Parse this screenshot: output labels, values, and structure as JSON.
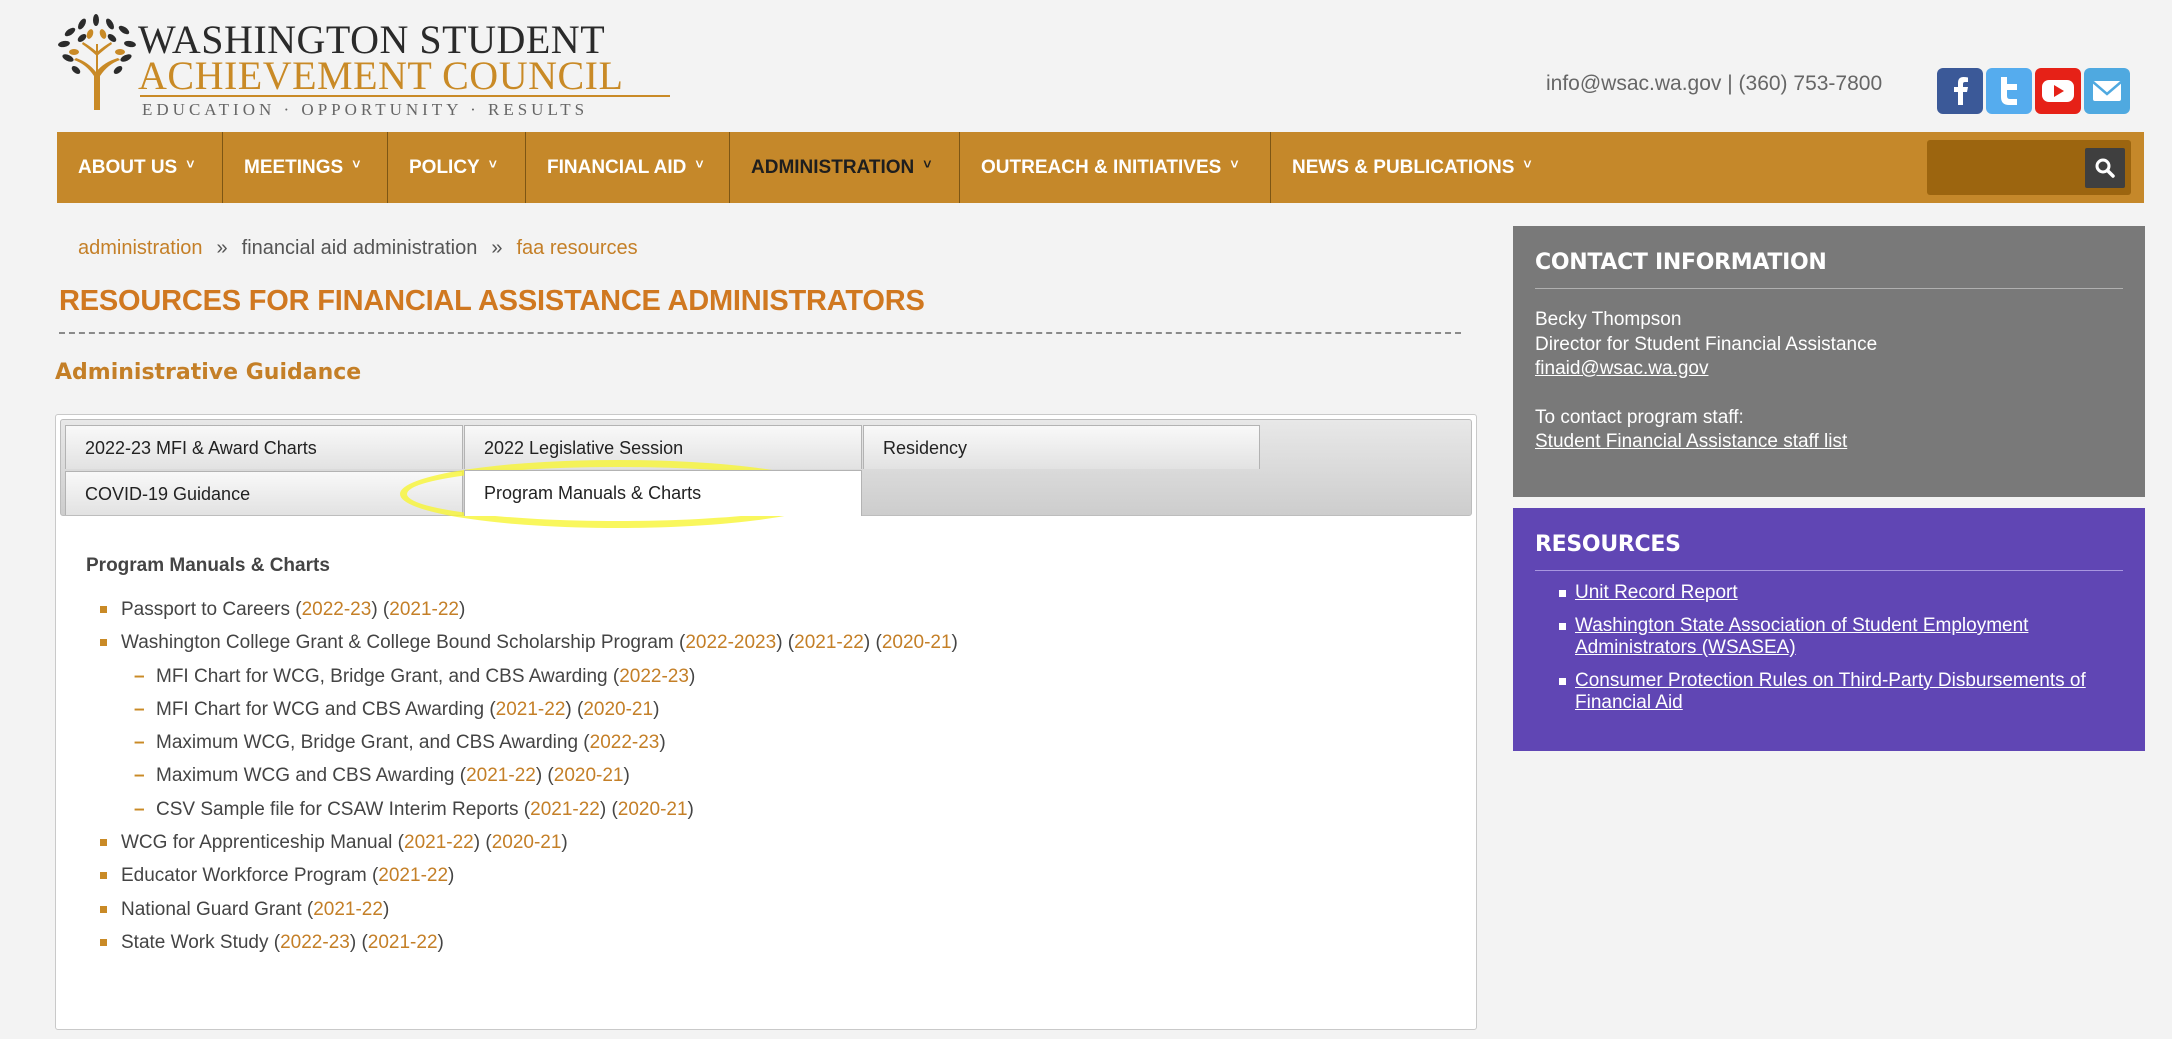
{
  "header": {
    "logo_line1": "WASHINGTON STUDENT",
    "logo_line2": "ACHIEVEMENT COUNCIL",
    "logo_tagline": "EDUCATION · OPPORTUNITY · RESULTS",
    "contact_email": "info@wsac.wa.gov",
    "contact_separator": " | ",
    "contact_phone": "(360) 753-7800",
    "social": [
      {
        "icon": "facebook-icon",
        "color": "#3b5998"
      },
      {
        "icon": "twitter-icon",
        "color": "#55acee"
      },
      {
        "icon": "youtube-icon",
        "color": "#e62117"
      },
      {
        "icon": "email-icon",
        "color": "#4fa9e0"
      }
    ]
  },
  "nav": {
    "items": [
      {
        "label": "ABOUT US",
        "active": false
      },
      {
        "label": "MEETINGS",
        "active": false
      },
      {
        "label": "POLICY",
        "active": false
      },
      {
        "label": "FINANCIAL AID",
        "active": false
      },
      {
        "label": "ADMINISTRATION",
        "active": true
      },
      {
        "label": "OUTREACH & INITIATIVES",
        "active": false
      },
      {
        "label": "NEWS & PUBLICATIONS",
        "active": false
      }
    ],
    "caret": "˅",
    "search_icon": "search-icon",
    "background": "#c5882a"
  },
  "breadcrumb": {
    "items": [
      "administration",
      "financial aid administration",
      "faa resources"
    ],
    "separator": "»"
  },
  "page_title": "RESOURCES FOR FINANCIAL ASSISTANCE ADMINISTRATORS",
  "section_title": "Administrative Guidance",
  "tabs": [
    {
      "label": "2022-23 MFI & Award Charts",
      "active": false
    },
    {
      "label": "2022 Legislative Session",
      "active": false
    },
    {
      "label": "Residency",
      "active": false
    },
    {
      "label": "COVID-19 Guidance",
      "active": false
    },
    {
      "label": "Program Manuals & Charts",
      "active": true
    }
  ],
  "content": {
    "title": "Program Manuals & Charts",
    "items": [
      {
        "text": "Passport to Careers",
        "links": [
          "2022-23",
          "2021-22"
        ]
      },
      {
        "text": "Washington College Grant & College Bound Scholarship Program",
        "links": [
          "2022-2023",
          "2021-22",
          "2020-21"
        ],
        "sub": [
          {
            "text": "MFI Chart for WCG, Bridge Grant, and CBS Awarding",
            "links": [
              "2022-23"
            ]
          },
          {
            "text": "MFI Chart for WCG and CBS Awarding",
            "links": [
              "2021-22",
              "2020-21"
            ]
          },
          {
            "text": "Maximum WCG, Bridge Grant, and CBS Awarding",
            "links": [
              "2022-23"
            ]
          },
          {
            "text": "Maximum WCG and CBS Awarding",
            "links": [
              "2021-22",
              "2020-21"
            ]
          },
          {
            "text": "CSV Sample file for CSAW Interim Reports",
            "links": [
              "2021-22",
              "2020-21"
            ]
          }
        ]
      },
      {
        "text": "WCG for Apprenticeship Manual",
        "links": [
          "2021-22",
          "2020-21"
        ]
      },
      {
        "text": "Educator Workforce Program",
        "links": [
          "2021-22"
        ]
      },
      {
        "text": "National Guard Grant",
        "links": [
          "2021-22"
        ]
      },
      {
        "text": "State Work Study",
        "links": [
          "2022-23",
          "2021-22"
        ]
      }
    ]
  },
  "sidebar": {
    "contact": {
      "title": "CONTACT INFORMATION",
      "name": "Becky Thompson",
      "role": "Director for Student Financial Assistance",
      "email": "finaid@wsac.wa.gov",
      "staff_prompt": "To contact program staff:",
      "staff_link": "Student Financial Assistance staff list",
      "background": "#797979"
    },
    "resources": {
      "title": "RESOURCES",
      "links": [
        "Unit Record Report",
        "Washington State Association of Student Employment Administrators (WSASEA)",
        "Consumer Protection Rules on Third-Party Disbursements of Financial Aid"
      ],
      "background": "#6046b4"
    }
  }
}
